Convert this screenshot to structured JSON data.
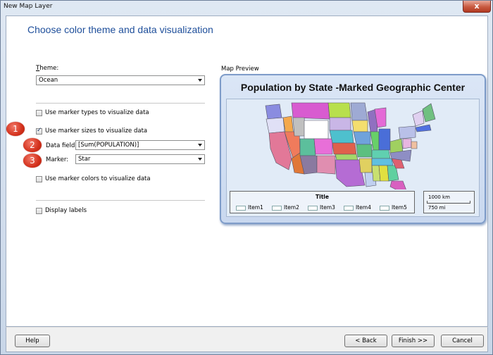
{
  "window": {
    "title": "New Map Layer",
    "close_label": "x"
  },
  "heading": "Choose color theme and data visualization",
  "theme": {
    "label_u": "T",
    "label_rest": "heme:",
    "value": "Ocean"
  },
  "options": {
    "marker_types": "Use marker types to visualize data",
    "marker_sizes": "Use marker sizes to visualize data",
    "data_field_label": "Data field:",
    "data_field_value": "[Sum(POPULATION)]",
    "marker_label": "Marker:",
    "marker_value": "Star",
    "marker_colors": "Use marker colors to visualize data",
    "display_labels": "Display labels"
  },
  "checkboxes": {
    "marker_types": false,
    "marker_sizes": true,
    "marker_colors": false,
    "display_labels": false
  },
  "badges": [
    "1",
    "2",
    "3"
  ],
  "preview": {
    "section_label": "Map Preview",
    "title": "Population by State -Marked Geographic Center",
    "legend_title": "Title",
    "legend_items": [
      "Item1",
      "Item2",
      "Item3",
      "Item4",
      "Item5"
    ],
    "scale_km": "1000 km",
    "scale_mi": "750 mi"
  },
  "buttons": {
    "help": "Help",
    "back": "< Back",
    "finish": "Finish >>",
    "cancel": "Cancel"
  },
  "colors": {
    "heading": "#1f4f9b",
    "badge": "#d3301b"
  }
}
